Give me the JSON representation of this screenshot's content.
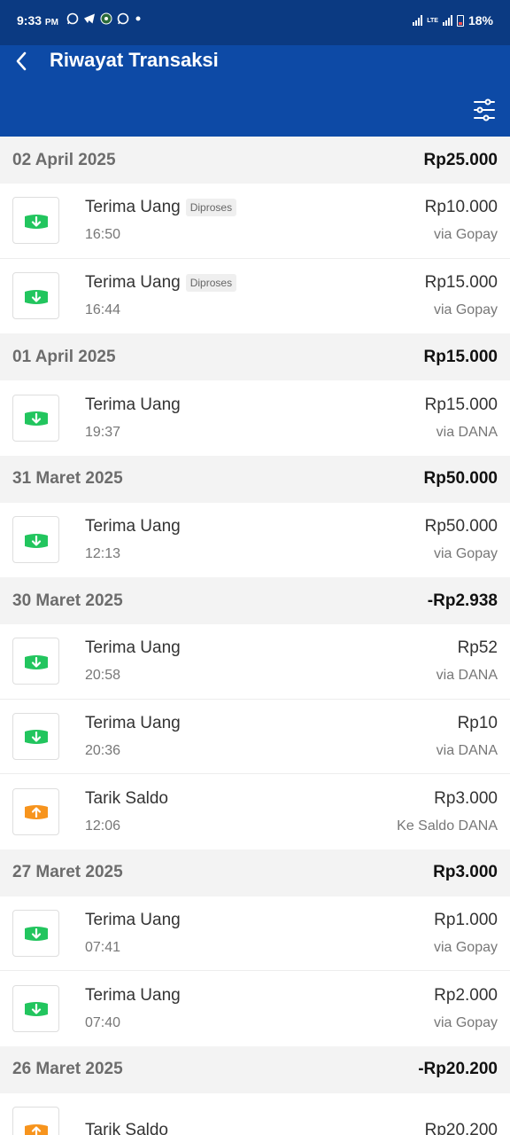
{
  "status_bar": {
    "time": "9:33",
    "ampm": "PM",
    "battery": "18%"
  },
  "header": {
    "title": "Riwayat Transaksi"
  },
  "colors": {
    "receive": "#22c55e",
    "withdraw": "#f7941d",
    "header": "#0d4aa6"
  },
  "groups": [
    {
      "date": "02 April 2025",
      "total": "Rp25.000",
      "items": [
        {
          "type": "receive",
          "title": "Terima Uang",
          "badge": "Diproses",
          "time": "16:50",
          "amount": "Rp10.000",
          "via": "via Gopay"
        },
        {
          "type": "receive",
          "title": "Terima Uang",
          "badge": "Diproses",
          "time": "16:44",
          "amount": "Rp15.000",
          "via": "via Gopay"
        }
      ]
    },
    {
      "date": "01 April 2025",
      "total": "Rp15.000",
      "items": [
        {
          "type": "receive",
          "title": "Terima Uang",
          "badge": "",
          "time": "19:37",
          "amount": "Rp15.000",
          "via": "via DANA"
        }
      ]
    },
    {
      "date": "31 Maret 2025",
      "total": "Rp50.000",
      "items": [
        {
          "type": "receive",
          "title": "Terima Uang",
          "badge": "",
          "time": "12:13",
          "amount": "Rp50.000",
          "via": "via Gopay"
        }
      ]
    },
    {
      "date": "30 Maret 2025",
      "total": "-Rp2.938",
      "items": [
        {
          "type": "receive",
          "title": "Terima Uang",
          "badge": "",
          "time": "20:58",
          "amount": "Rp52",
          "via": "via DANA"
        },
        {
          "type": "receive",
          "title": "Terima Uang",
          "badge": "",
          "time": "20:36",
          "amount": "Rp10",
          "via": "via DANA"
        },
        {
          "type": "withdraw",
          "title": "Tarik Saldo",
          "badge": "",
          "time": "12:06",
          "amount": "Rp3.000",
          "via": "Ke Saldo DANA"
        }
      ]
    },
    {
      "date": "27 Maret 2025",
      "total": "Rp3.000",
      "items": [
        {
          "type": "receive",
          "title": "Terima Uang",
          "badge": "",
          "time": "07:41",
          "amount": "Rp1.000",
          "via": "via Gopay"
        },
        {
          "type": "receive",
          "title": "Terima Uang",
          "badge": "",
          "time": "07:40",
          "amount": "Rp2.000",
          "via": "via Gopay"
        }
      ]
    },
    {
      "date": "26 Maret 2025",
      "total": "-Rp20.200",
      "items": [
        {
          "type": "withdraw",
          "title": "Tarik Saldo",
          "badge": "",
          "time": "",
          "amount": "Rp20.200",
          "via": ""
        }
      ]
    }
  ]
}
